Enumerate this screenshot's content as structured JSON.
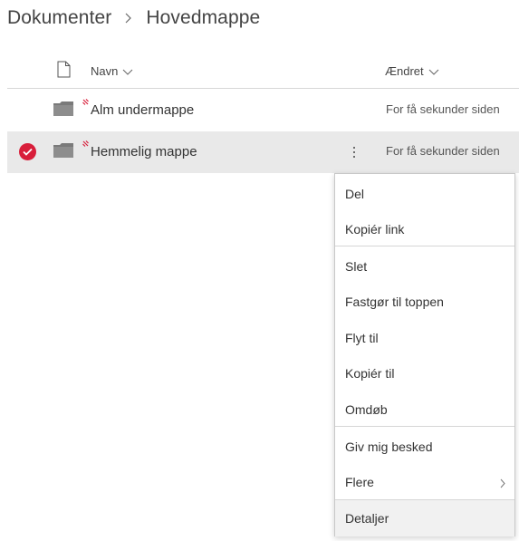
{
  "breadcrumb": {
    "root": "Dokumenter",
    "current": "Hovedmappe"
  },
  "columns": {
    "name": "Navn",
    "modified": "Ændret"
  },
  "rows": [
    {
      "name": "Alm undermappe",
      "modified": "For få sekunder siden",
      "selected": false
    },
    {
      "name": "Hemmelig mappe",
      "modified": "For få sekunder siden",
      "selected": true
    }
  ],
  "context_menu": {
    "items": [
      {
        "label": "Del"
      },
      {
        "label": "Kopiér link"
      },
      {
        "label": "Slet"
      },
      {
        "label": "Fastgør til toppen"
      },
      {
        "label": "Flyt til"
      },
      {
        "label": "Kopiér til"
      },
      {
        "label": "Omdøb"
      },
      {
        "label": "Giv mig besked"
      },
      {
        "label": "Flere",
        "has_submenu": true
      },
      {
        "label": "Detaljer",
        "highlighted": true
      }
    ]
  },
  "colors": {
    "accent": "#d81e3a",
    "selected_row": "#e9e9e9"
  }
}
